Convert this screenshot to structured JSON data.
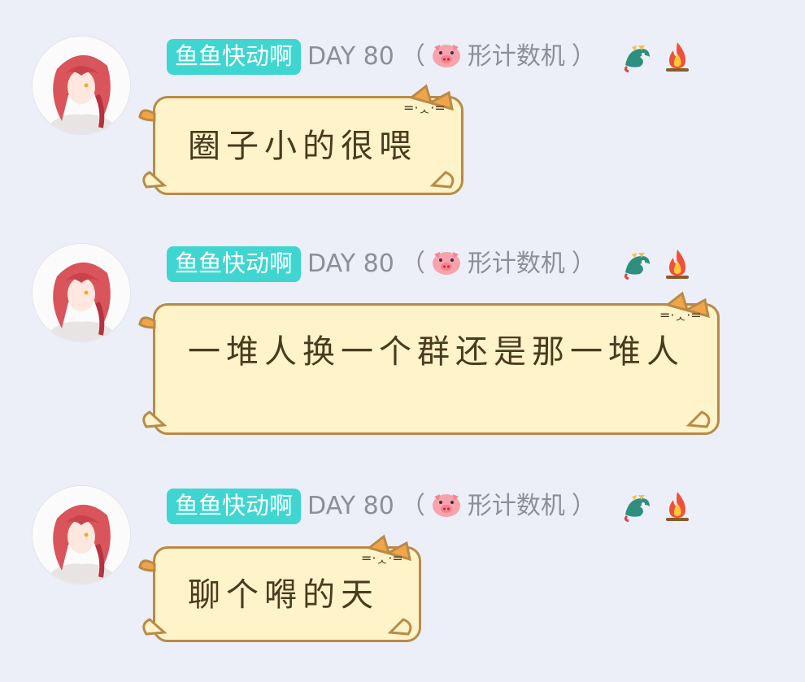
{
  "messages": [
    {
      "nickname": "鱼鱼快动啊",
      "day": "DAY 80",
      "open_paren": "（",
      "title": "形计数机",
      "close_paren": "）",
      "text": "圈子小的很喂"
    },
    {
      "nickname": "鱼鱼快动啊",
      "day": "DAY 80",
      "open_paren": "（",
      "title": "形计数机",
      "close_paren": "）",
      "text": "一堆人换一个群还是那一堆人"
    },
    {
      "nickname": "鱼鱼快动啊",
      "day": "DAY 80",
      "open_paren": "（",
      "title": "形计数机",
      "close_paren": "）",
      "text": "聊个嘚的天"
    }
  ],
  "icons": {
    "avatar": "avatar-red-hair-girl",
    "pig": "pig-face-icon",
    "dragon": "dragon-icon",
    "fire": "fire-icon",
    "bubble_decoration": "cat-bubble-decoration"
  },
  "colors": {
    "background": "#eceef8",
    "nickname_bg": "#3fd6d1",
    "bubble_fill": "#fff3c9",
    "bubble_border": "#b98a47",
    "title_text": "#8e8e98"
  }
}
